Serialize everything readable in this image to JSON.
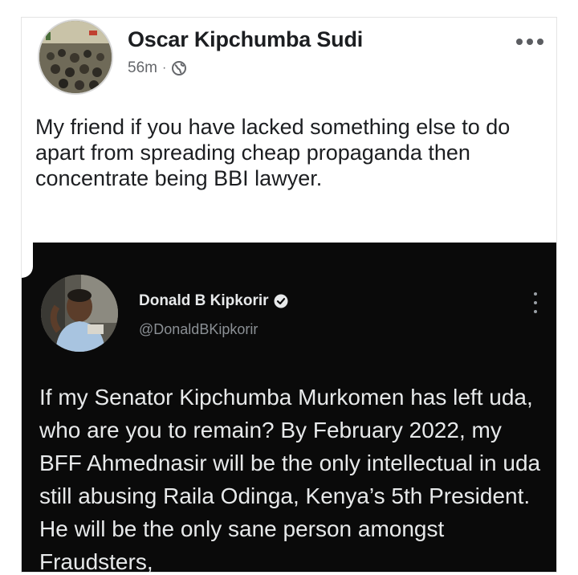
{
  "facebook_post": {
    "author_name": "Oscar Kipchumba Sudi",
    "time_ago": "56m",
    "separator": "·",
    "privacy_icon": "globe-icon",
    "more_icon": "more-horizontal-icon",
    "text": "My friend if you have lacked something else to do apart from spreading cheap propaganda then concentrate being BBI lawyer."
  },
  "embedded_tweet": {
    "display_name": "Donald B Kipkorir",
    "verified_icon": "verified-badge-icon",
    "handle": "@DonaldBKipkorir",
    "more_icon": "more-vertical-icon",
    "text": "If my Senator Kipchumba Murkomen has left uda, who are you to remain?  By February 2022, my BFF Ahmednasir will be the only intellectual in uda still abusing Raila Odinga, Kenya’s 5th President. He will be the only sane person amongst Fraudsters,"
  },
  "colors": {
    "fb_text": "#1c1e21",
    "fb_meta": "#65676b",
    "tweet_bg": "#0a0a0a",
    "tweet_text": "#e7e9ea",
    "tweet_handle": "#8b9095"
  }
}
